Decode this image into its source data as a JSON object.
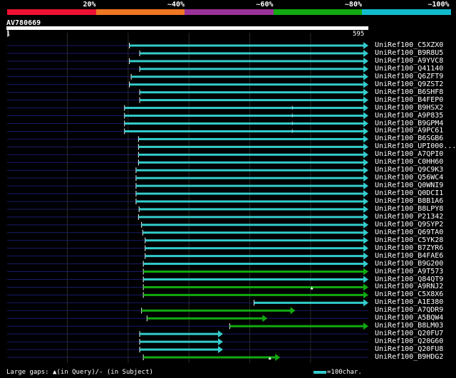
{
  "header": {
    "percent_labels": [
      "20%",
      "~40%",
      "~60%",
      "~80%",
      "~100%"
    ],
    "color_bands": [
      "#ee1133",
      "#ee7722",
      "#993399",
      "#11aa11",
      "#11bbcc"
    ]
  },
  "query": {
    "name": "AV780669",
    "start": "1",
    "end": "595",
    "length": 595
  },
  "colors": {
    "cyan": "#33cccc",
    "green": "#11aa11",
    "guide": "#1a1a6a",
    "grid": "#2a2a2a"
  },
  "hits": [
    {
      "label": "UniRef100_C5XZX0",
      "start": 202,
      "end": 595,
      "color": "cyan"
    },
    {
      "label": "UniRef100_B9R8U5",
      "start": 219,
      "end": 595,
      "color": "cyan"
    },
    {
      "label": "UniRef100_A9YVC8",
      "start": 202,
      "end": 595,
      "color": "cyan"
    },
    {
      "label": "UniRef100_Q41140",
      "start": 219,
      "end": 595,
      "color": "cyan"
    },
    {
      "label": "UniRef100_Q6ZFT9",
      "start": 205,
      "end": 595,
      "color": "cyan"
    },
    {
      "label": "UniRef100_Q9ZST2",
      "start": 202,
      "end": 595,
      "color": "cyan"
    },
    {
      "label": "UniRef100_B6SHF8",
      "start": 219,
      "end": 595,
      "color": "cyan"
    },
    {
      "label": "UniRef100_B4FEP0",
      "start": 219,
      "end": 595,
      "color": "cyan"
    },
    {
      "label": "UniRef100_B9HSX2",
      "start": 194,
      "end": 595,
      "color": "cyan",
      "mark": 470
    },
    {
      "label": "UniRef100_A9P835",
      "start": 194,
      "end": 595,
      "color": "cyan",
      "mark": 470
    },
    {
      "label": "UniRef100_B9GPM4",
      "start": 194,
      "end": 595,
      "color": "cyan",
      "mark": 470
    },
    {
      "label": "UniRef100_A9PC61",
      "start": 194,
      "end": 595,
      "color": "cyan",
      "mark": 470
    },
    {
      "label": "UniRef100_B6SGB6",
      "start": 217,
      "end": 595,
      "color": "cyan"
    },
    {
      "label": "UniRef100_UPI000...",
      "start": 217,
      "end": 595,
      "color": "cyan"
    },
    {
      "label": "UniRef100_A7QPI0",
      "start": 217,
      "end": 595,
      "color": "cyan"
    },
    {
      "label": "UniRef100_C0HH60",
      "start": 217,
      "end": 595,
      "color": "cyan"
    },
    {
      "label": "UniRef100_Q9C9K3",
      "start": 213,
      "end": 595,
      "color": "cyan"
    },
    {
      "label": "UniRef100_Q56WC4",
      "start": 213,
      "end": 595,
      "color": "cyan"
    },
    {
      "label": "UniRef100_Q0WNI9",
      "start": 213,
      "end": 595,
      "color": "cyan"
    },
    {
      "label": "UniRef100_Q0DCI1",
      "start": 213,
      "end": 595,
      "color": "cyan"
    },
    {
      "label": "UniRef100_B8B1A6",
      "start": 213,
      "end": 595,
      "color": "cyan"
    },
    {
      "label": "UniRef100_B8LPY8",
      "start": 218,
      "end": 595,
      "color": "cyan"
    },
    {
      "label": "UniRef100_P21342",
      "start": 217,
      "end": 595,
      "color": "cyan"
    },
    {
      "label": "UniRef100_Q9SYP2",
      "start": 222,
      "end": 595,
      "color": "cyan"
    },
    {
      "label": "UniRef100_Q69TA0",
      "start": 224,
      "end": 595,
      "color": "cyan"
    },
    {
      "label": "UniRef100_C5YK28",
      "start": 228,
      "end": 595,
      "color": "cyan"
    },
    {
      "label": "UniRef100_B7ZYR6",
      "start": 228,
      "end": 595,
      "color": "cyan"
    },
    {
      "label": "UniRef100_B4FAE6",
      "start": 228,
      "end": 595,
      "color": "cyan"
    },
    {
      "label": "UniRef100_B9G200",
      "start": 225,
      "end": 595,
      "color": "cyan"
    },
    {
      "label": "UniRef100_A9T573",
      "start": 225,
      "end": 595,
      "color": "green"
    },
    {
      "label": "UniRef100_Q84QT9",
      "start": 225,
      "end": 595,
      "color": "cyan"
    },
    {
      "label": "UniRef100_A9RNJ2",
      "start": 225,
      "end": 595,
      "color": "green",
      "query_gap": 502
    },
    {
      "label": "UniRef100_C5X8X6",
      "start": 225,
      "end": 595,
      "color": "green"
    },
    {
      "label": "UniRef100_A1E380",
      "start": 407,
      "end": 595,
      "color": "cyan"
    },
    {
      "label": "UniRef100_A7QDR9",
      "start": 222,
      "end": 475,
      "color": "green"
    },
    {
      "label": "UniRef100_A5BQW4",
      "start": 231,
      "end": 429,
      "color": "green"
    },
    {
      "label": "UniRef100_B8LM03",
      "start": 367,
      "end": 595,
      "color": "green"
    },
    {
      "label": "UniRef100_Q20FU7",
      "start": 219,
      "end": 356,
      "color": "cyan"
    },
    {
      "label": "UniRef100_Q20G60",
      "start": 219,
      "end": 356,
      "color": "cyan"
    },
    {
      "label": "UniRef100_Q20FU8",
      "start": 219,
      "end": 356,
      "color": "cyan"
    },
    {
      "label": "UniRef100_B9HDG2",
      "start": 225,
      "end": 450,
      "color": "green",
      "query_gap": 433
    }
  ],
  "footer": {
    "gaps_text": "Large gaps: ▲(in Query)/- (in Subject)",
    "scale_text": "=100char."
  }
}
